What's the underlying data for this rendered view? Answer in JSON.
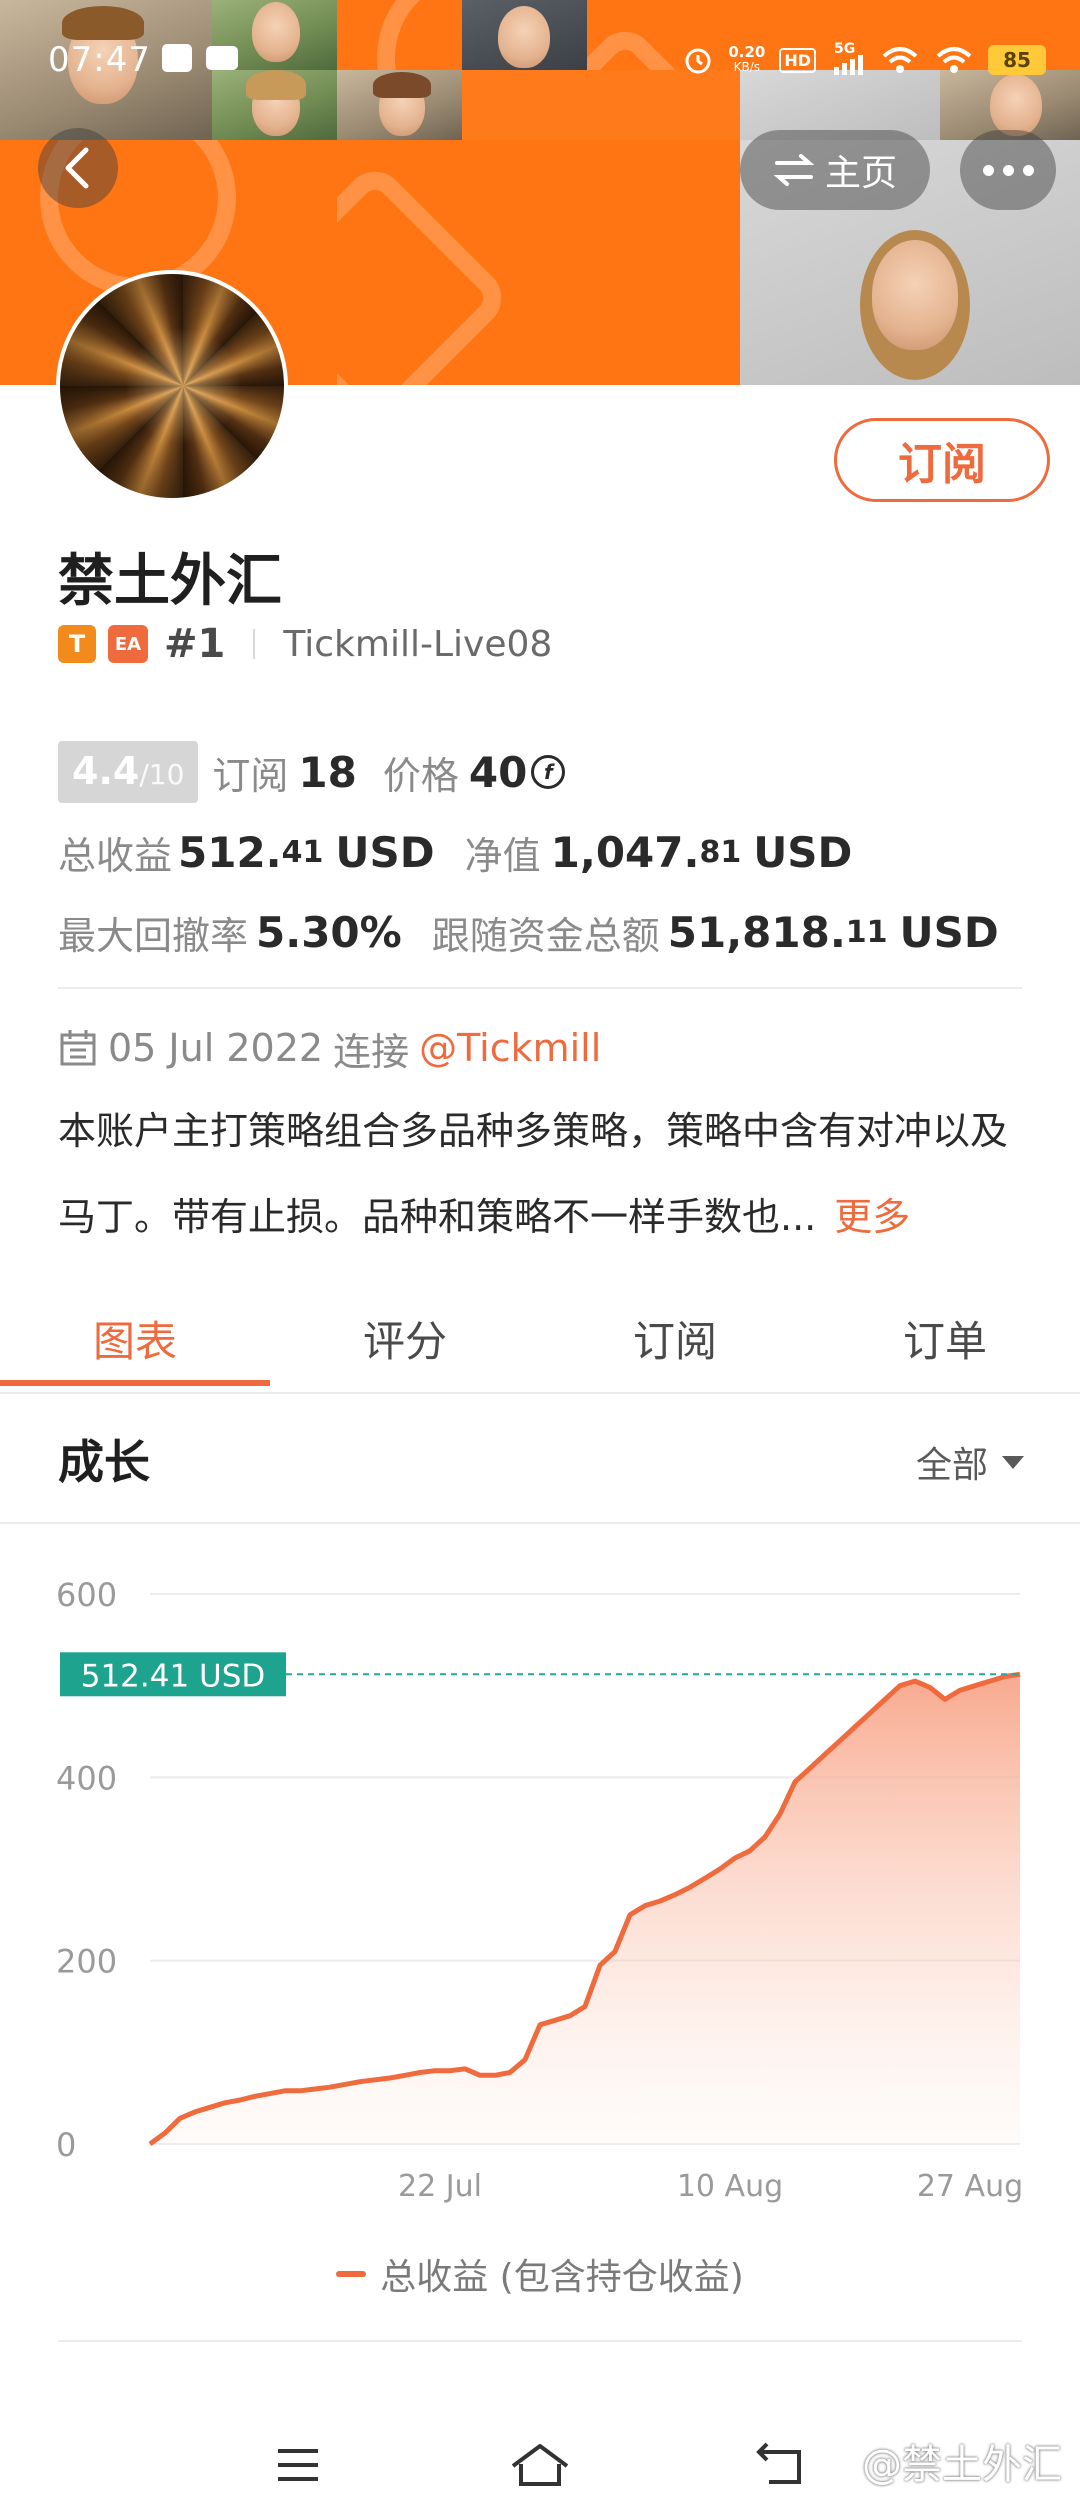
{
  "status_bar": {
    "time": "07:47",
    "net_speed_value": "0.20",
    "net_speed_unit": "KB/s",
    "hd_label": "HD",
    "signal_label": "5G",
    "battery": "85"
  },
  "header": {
    "home_label": "主页"
  },
  "profile": {
    "name": "禁土外汇",
    "badge_t": "T",
    "badge_ea": "EA",
    "rank": "#1",
    "broker": "Tickmill-Live08",
    "subscribe_label": "订阅"
  },
  "stats": {
    "score": "4.4",
    "score_max": "/10",
    "subs_label": "订阅",
    "subs_value": "18",
    "price_label": "价格",
    "price_value": "40",
    "price_currency_symbol": "f",
    "total_profit_label": "总收益",
    "total_profit_int": "512.",
    "total_profit_dec": "41",
    "total_profit_unit": "USD",
    "equity_label": "净值",
    "equity_int": "1,047.",
    "equity_dec": "81",
    "equity_unit": "USD",
    "max_dd_label": "最大回撤率",
    "max_dd_value": "5.30%",
    "follow_funds_label": "跟随资金总额",
    "follow_funds_int": "51,818.",
    "follow_funds_dec": "11",
    "follow_funds_unit": "USD"
  },
  "connection": {
    "date": "05 Jul 2022",
    "connect_label": "连接",
    "link": "@Tickmill"
  },
  "description": {
    "text": "本账户主打策略组合多品种多策略，策略中含有对冲以及马丁。带有止损。品种和策略不一样手数也...",
    "more_label": "更多"
  },
  "tabs": [
    "图表",
    "评分",
    "订阅",
    "订单"
  ],
  "growth_section": {
    "title": "成长",
    "range": "全部"
  },
  "chart_data": {
    "type": "area",
    "yticks": [
      "600",
      "400",
      "200",
      "0"
    ],
    "ylim": [
      0,
      600
    ],
    "xtick_labels": [
      "22 Jul",
      "10 Aug",
      "27 Aug"
    ],
    "current_label": "512.41 USD",
    "current_value": 512.41,
    "series": [
      {
        "name": "总收益 (包含持仓收益)",
        "color": "#ef6a3c",
        "values": [
          0,
          12,
          28,
          35,
          40,
          45,
          48,
          52,
          55,
          58,
          58,
          60,
          62,
          65,
          68,
          70,
          72,
          75,
          78,
          80,
          80,
          82,
          75,
          75,
          78,
          92,
          130,
          135,
          140,
          150,
          195,
          210,
          250,
          260,
          265,
          272,
          280,
          290,
          300,
          312,
          320,
          335,
          360,
          395,
          410,
          425,
          440,
          455,
          470,
          485,
          500,
          505,
          498,
          485,
          495,
          500,
          505,
          510,
          512.41
        ]
      }
    ]
  },
  "watermark": "@禁土外汇"
}
